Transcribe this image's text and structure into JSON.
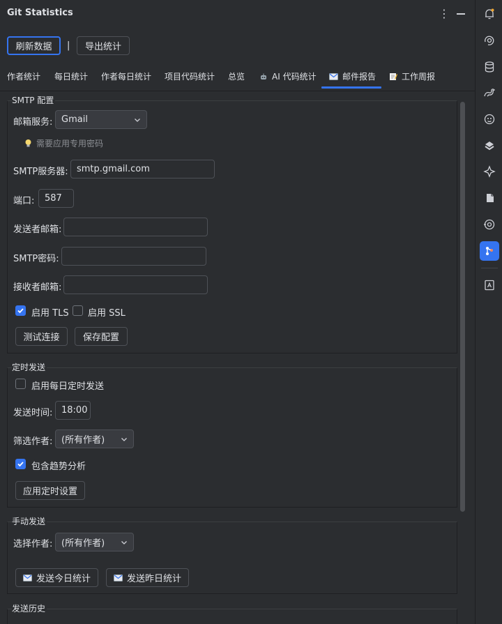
{
  "window": {
    "title": "Git Statistics",
    "menu_icon": "more-vertical-icon",
    "minimize_icon": "minimize-icon"
  },
  "toolbar": {
    "refresh_label": "刷新数据",
    "separator": "|",
    "export_label": "导出统计"
  },
  "tabs": [
    {
      "label": "作者统计"
    },
    {
      "label": "每日统计"
    },
    {
      "label": "作者每日统计"
    },
    {
      "label": "项目代码统计"
    },
    {
      "label": "总览"
    },
    {
      "label": "AI 代码统计",
      "icon": "robot-icon"
    },
    {
      "label": "邮件报告",
      "icon": "email-icon",
      "active": true
    },
    {
      "label": "工作周报",
      "icon": "memo-icon"
    }
  ],
  "smtp": {
    "title": "SMTP 配置",
    "service_label": "邮箱服务:",
    "service_value": "Gmail",
    "hint": "需要应用专用密码",
    "server_label": "SMTP服务器:",
    "server_value": "smtp.gmail.com",
    "port_label": "端口:",
    "port_value": "587",
    "sender_label": "发送者邮箱:",
    "sender_value": "",
    "password_label": "SMTP密码:",
    "password_value": "",
    "receiver_label": "接收者邮箱:",
    "receiver_value": "",
    "tls_label": "启用 TLS",
    "tls_checked": true,
    "ssl_label": "启用 SSL",
    "ssl_checked": false,
    "test_label": "测试连接",
    "save_label": "保存配置"
  },
  "schedule": {
    "title": "定时发送",
    "daily_label": "启用每日定时发送",
    "daily_checked": false,
    "time_label": "发送时间:",
    "time_value": "18:00",
    "author_label": "筛选作者:",
    "author_value": "(所有作者)",
    "trend_label": "包含趋势分析",
    "trend_checked": true,
    "apply_label": "应用定时设置"
  },
  "manual": {
    "title": "手动发送",
    "author_label": "选择作者:",
    "author_value": "(所有作者)",
    "send_today_label": "发送今日统计",
    "send_yesterday_label": "发送昨日统计"
  },
  "history": {
    "title": "发送历史"
  },
  "sidebar": {
    "icons": [
      "notifications-icon",
      "ai-assistant-icon",
      "database-icon",
      "gradle-icon",
      "copilot-icon",
      "plugin-icon",
      "ai-spark-icon",
      "layers-icon",
      "target-icon",
      "git-statistics-icon",
      "dictionary-icon"
    ],
    "active": "git-statistics-icon"
  },
  "colors": {
    "accent": "#3574f0",
    "background": "#2b2d30",
    "text": "#dfe1e5"
  }
}
